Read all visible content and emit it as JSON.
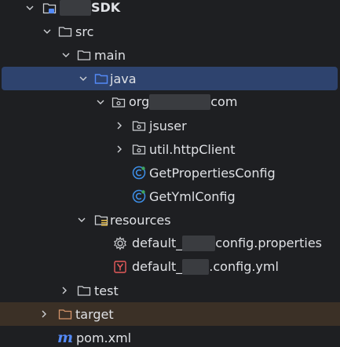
{
  "tree": {
    "rows": [
      {
        "label_pre": "",
        "label_post": "SDK",
        "icon": "module-folder-icon",
        "expanded": true
      },
      {
        "label": "src",
        "icon": "folder-icon",
        "expanded": true
      },
      {
        "label": "main",
        "icon": "folder-icon",
        "expanded": true
      },
      {
        "label": "java",
        "icon": "source-root-folder-icon",
        "expanded": true,
        "selected": true
      },
      {
        "label_pre": "org",
        "label_post": "com",
        "icon": "package-icon",
        "expanded": true
      },
      {
        "label": "jsuser",
        "icon": "package-icon",
        "expanded": false
      },
      {
        "label": "util.httpClient",
        "icon": "package-icon",
        "expanded": false
      },
      {
        "label": "GetPropertiesConfig",
        "icon": "java-class-icon"
      },
      {
        "label": "GetYmlConfig",
        "icon": "java-class-icon"
      },
      {
        "label": "resources",
        "icon": "resources-folder-icon",
        "expanded": true
      },
      {
        "label_pre": "default_",
        "label_post": "config.properties",
        "icon": "properties-gear-icon"
      },
      {
        "label_pre": "default_",
        "label_post": ".config.yml",
        "icon": "yaml-file-icon"
      },
      {
        "label": "test",
        "icon": "folder-icon",
        "expanded": false
      },
      {
        "label": "target",
        "icon": "excluded-folder-icon",
        "expanded": false,
        "excluded": true
      },
      {
        "label": "pom.xml",
        "icon": "maven-icon"
      }
    ]
  },
  "colors": {
    "background": "#1e1f22",
    "selection": "#2e436e",
    "excluded_row": "#3b3026",
    "text": "#dfe1e5",
    "excluded_text": "#d5956a",
    "accent_blue": "#548af7",
    "class_icon": "#3d8fe8",
    "yaml_red": "#e55b5b"
  }
}
